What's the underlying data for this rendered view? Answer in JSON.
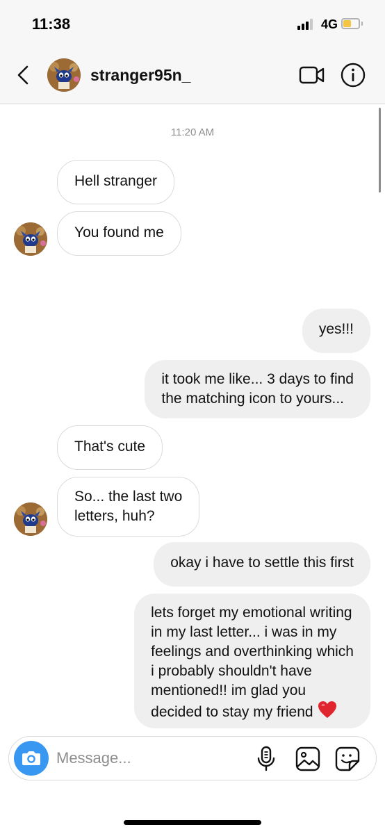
{
  "status_bar": {
    "time": "11:38",
    "network": "4G"
  },
  "header": {
    "username": "stranger95n_"
  },
  "conversation": {
    "timestamp": "11:20 AM",
    "messages": [
      {
        "side": "in",
        "text": "Hell stranger"
      },
      {
        "side": "in",
        "text": "You found me"
      },
      {
        "side": "out",
        "text": "yes!!!"
      },
      {
        "side": "out",
        "lines": [
          "it took me like... 3 days to find",
          "the matching icon to yours..."
        ]
      },
      {
        "side": "in",
        "text": "That's cute"
      },
      {
        "side": "in",
        "lines": [
          "So... the last two",
          "letters, huh?"
        ]
      },
      {
        "side": "out",
        "text": "okay i have to settle this first"
      },
      {
        "side": "out",
        "lines": [
          "lets forget my emotional writing",
          "in my last letter... i was in my",
          "feelings and overthinking which",
          "i probably shouldn't have",
          "mentioned!! im glad you",
          "decided to stay my friend"
        ],
        "emoji": "heart-icon"
      }
    ]
  },
  "composer": {
    "placeholder": "Message..."
  },
  "colors": {
    "accent": "#3897f0",
    "outgoing_bubble": "#efefef",
    "incoming_border": "#dbdbdb",
    "heart": "#e0252f"
  }
}
